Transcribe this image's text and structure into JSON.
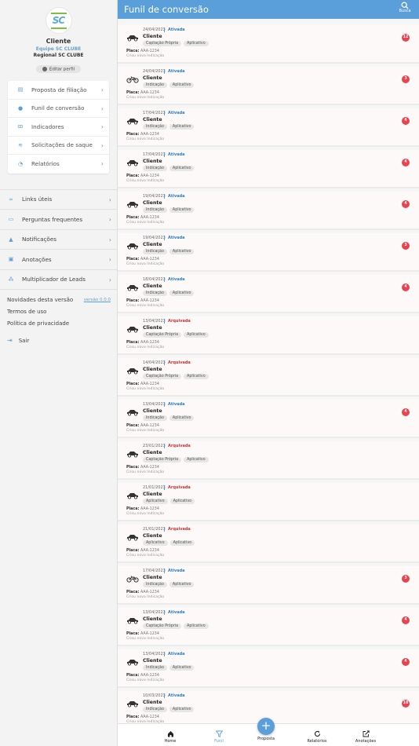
{
  "header": {
    "title": "Funil de conversão",
    "search_label": "Busca"
  },
  "profile": {
    "logo_text": "SC",
    "name": "Cliente",
    "team": "Equipe SC CLUBE",
    "regional": "Regional SC CLUBE",
    "edit_label": "Editar perfil"
  },
  "menu_card": [
    {
      "label": "Proposta de filiação",
      "icon": "document-icon"
    },
    {
      "label": "Funil de conversão",
      "icon": "location-pin-icon"
    },
    {
      "label": "Indicadores",
      "icon": "people-icon"
    },
    {
      "label": "Solicitações de saque",
      "icon": "withdraw-icon"
    },
    {
      "label": "Relatórios",
      "icon": "pie-chart-icon"
    }
  ],
  "menu_list": [
    {
      "label": "Links úteis",
      "icon": "link-icon"
    },
    {
      "label": "Perguntas frequentes",
      "icon": "chat-icon"
    },
    {
      "label": "Notificações",
      "icon": "bell-icon"
    },
    {
      "label": "Anotações",
      "icon": "notes-icon"
    },
    {
      "label": "Multiplicador de Leads",
      "icon": "share-icon"
    }
  ],
  "bottom_links": {
    "news_label": "Novidades desta versão",
    "version_label": "versão 0.0.0",
    "terms_label": "Termos de uso",
    "privacy_label": "Política de privacidade",
    "logout_label": "Sair"
  },
  "leads": [
    {
      "date": "24/04/2023",
      "status": "Ativada",
      "name": "Cliente",
      "tags": [
        "Captação Própria",
        "Aplicativo"
      ],
      "plate_label": "Placa:",
      "plate": "AAA-1234",
      "subtitle": "Criou nova Indicação",
      "badge": "12",
      "vehicle": "car"
    },
    {
      "date": "24/04/2023",
      "status": "Ativada",
      "name": "Cliente",
      "tags": [
        "Indicação",
        "Aplicativo"
      ],
      "plate_label": "Placa:",
      "plate": "AAA-1234",
      "subtitle": "Criou nova Indicação",
      "badge": "3",
      "vehicle": "motorcycle"
    },
    {
      "date": "17/04/2023",
      "status": "Ativada",
      "name": "Cliente",
      "tags": [
        "Indicação",
        "Aplicativo"
      ],
      "plate_label": "Placa:",
      "plate": "AAA-1234",
      "subtitle": "Criou nova Indicação",
      "badge": "4",
      "vehicle": "car"
    },
    {
      "date": "17/04/2023",
      "status": "Ativada",
      "name": "Cliente",
      "tags": [
        "Indicação",
        "Aplicativo"
      ],
      "plate_label": "Placa:",
      "plate": "AAA-1234",
      "subtitle": "Criou nova Indicação",
      "badge": "4",
      "vehicle": "car"
    },
    {
      "date": "19/04/2023",
      "status": "Ativada",
      "name": "Cliente",
      "tags": [
        "Indicação",
        "Aplicativo"
      ],
      "plate_label": "Placa:",
      "plate": "AAA-1234",
      "subtitle": "Criou nova Indicação",
      "badge": "4",
      "vehicle": "car"
    },
    {
      "date": "19/04/2023",
      "status": "Ativada",
      "name": "Cliente",
      "tags": [
        "Indicação",
        "Aplicativo"
      ],
      "plate_label": "Placa:",
      "plate": "AAA-1234",
      "subtitle": "Criou nova Indicação",
      "badge": "3",
      "vehicle": "car"
    },
    {
      "date": "18/04/2023",
      "status": "Ativada",
      "name": "Cliente",
      "tags": [
        "Indicação",
        "Aplicativo"
      ],
      "plate_label": "Placa:",
      "plate": "AAA-1234",
      "subtitle": "Criou nova Indicação",
      "badge": "4",
      "vehicle": "car"
    },
    {
      "date": "13/04/2023",
      "status": "Arquivada",
      "name": "Cliente",
      "tags": [
        "Captação Própria",
        "Aplicativo"
      ],
      "plate_label": "Placa:",
      "plate": "AAA-1234",
      "subtitle": "Criou nova Indicação",
      "badge": "",
      "vehicle": "car"
    },
    {
      "date": "14/04/2023",
      "status": "Arquivada",
      "name": "Cliente",
      "tags": [
        "Captação Própria",
        "Aplicativo"
      ],
      "plate_label": "Placa:",
      "plate": "AAA-1234",
      "subtitle": "Criou nova Indicação",
      "badge": "",
      "vehicle": "car"
    },
    {
      "date": "13/04/2023",
      "status": "Ativada",
      "name": "Cliente",
      "tags": [
        "Indicação",
        "Aplicativo"
      ],
      "plate_label": "Placa:",
      "plate": "AAA-1234",
      "subtitle": "Criou nova Indicação",
      "badge": "4",
      "vehicle": "car"
    },
    {
      "date": "23/01/2023",
      "status": "Arquivada",
      "name": "Cliente",
      "tags": [
        "Captação Própria",
        "Aplicativo"
      ],
      "plate_label": "Placa:",
      "plate": "AAA-1234",
      "subtitle": "Criou nova Indicação",
      "badge": "",
      "vehicle": "car"
    },
    {
      "date": "21/01/2023",
      "status": "Arquivada",
      "name": "Cliente",
      "tags": [
        "Aplicativo",
        "Aplicativo"
      ],
      "plate_label": "Placa:",
      "plate": "AAA-1234",
      "subtitle": "Criou nova Indicação",
      "badge": "",
      "vehicle": "car"
    },
    {
      "date": "21/01/2023",
      "status": "Arquivada",
      "name": "Cliente",
      "tags": [
        "Aplicativo",
        "Aplicativo"
      ],
      "plate_label": "Placa:",
      "plate": "AAA-1234",
      "subtitle": "Criou nova Indicação",
      "badge": "",
      "vehicle": "car"
    },
    {
      "date": "17/04/2023",
      "status": "Ativada",
      "name": "Cliente",
      "tags": [
        "Indicação",
        "Aplicativo"
      ],
      "plate_label": "Placa:",
      "plate": "AAA-1234",
      "subtitle": "Criou nova Indicação",
      "badge": "3",
      "vehicle": "motorcycle"
    },
    {
      "date": "13/04/2023",
      "status": "Ativada",
      "name": "Cliente",
      "tags": [
        "Captação Própria",
        "Aplicativo"
      ],
      "plate_label": "Placa:",
      "plate": "AAA-1234",
      "subtitle": "Criou nova Indicação",
      "badge": "4",
      "vehicle": "car"
    },
    {
      "date": "13/04/2023",
      "status": "Ativada",
      "name": "Cliente",
      "tags": [
        "Indicação",
        "Aplicativo"
      ],
      "plate_label": "Placa:",
      "plate": "AAA-1234",
      "subtitle": "Criou nova Indicação",
      "badge": "4",
      "vehicle": "car"
    },
    {
      "date": "10/03/2023",
      "status": "Ativada",
      "name": "Cliente",
      "tags": [
        "Indicação",
        "Aplicativo"
      ],
      "plate_label": "Placa:",
      "plate": "AAA-1234",
      "subtitle": "Criou nova Indicação",
      "badge": "10",
      "vehicle": "car"
    }
  ],
  "bottom_nav": [
    {
      "label": "Home",
      "icon": "home-icon",
      "active": false
    },
    {
      "label": "Funil",
      "icon": "filter-icon",
      "active": true
    },
    {
      "label": "Proposta",
      "icon": "plus-icon",
      "active": false
    },
    {
      "label": "Relatórios",
      "icon": "refresh-icon",
      "active": false
    },
    {
      "label": "Anotações",
      "icon": "edit-icon",
      "active": false
    }
  ],
  "colors": {
    "primary": "#5b9fda",
    "badge": "#e8434f",
    "active_status": "#2e7fc8",
    "archived_status": "#d23232"
  }
}
